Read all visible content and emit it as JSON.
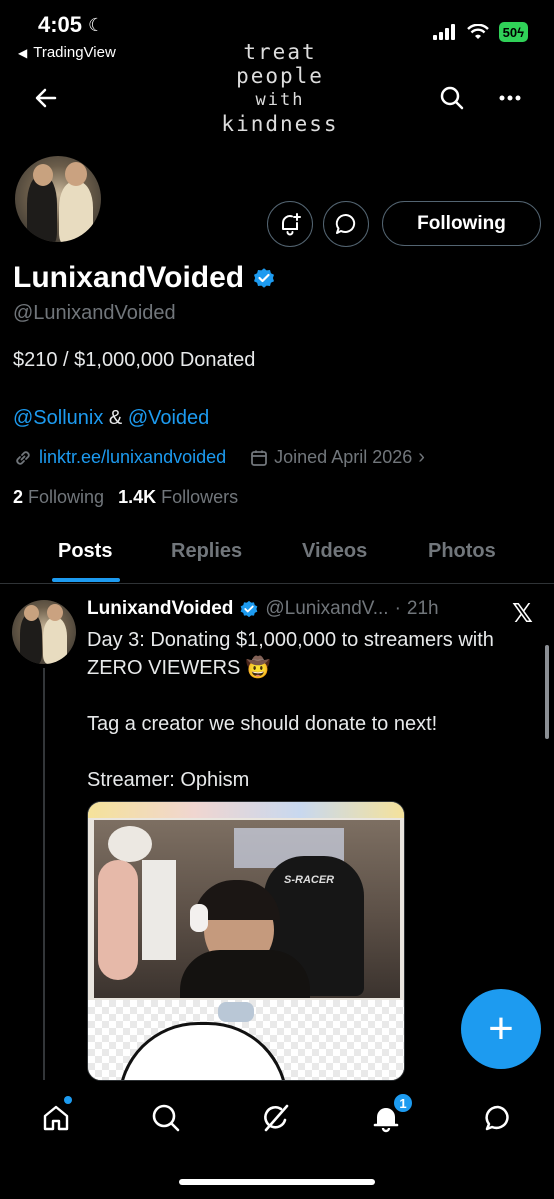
{
  "status_bar": {
    "time": "4:05",
    "back_app": "TradingView",
    "battery": "50"
  },
  "banner": {
    "text_lines": [
      "treat",
      "people",
      "with",
      "kindness"
    ]
  },
  "profile": {
    "name": "LunixandVoided",
    "handle": "@LunixandVoided",
    "bio_line1": "$210 / $1,000,000 Donated",
    "bio_mention1": "@Sollunix",
    "bio_and": "&",
    "bio_mention2": "@Voided",
    "website": "linktr.ee/lunixandvoided",
    "joined": "Joined April 2026",
    "following_count": "2",
    "following_label": "Following",
    "followers_count": "1.4K",
    "followers_label": "Followers",
    "follow_button": "Following"
  },
  "tabs": [
    {
      "label": "Posts",
      "active": true
    },
    {
      "label": "Replies",
      "active": false
    },
    {
      "label": "Videos",
      "active": false
    },
    {
      "label": "Photos",
      "active": false
    }
  ],
  "post": {
    "author": "LunixandVoided",
    "handle": "@LunixandV...",
    "separator": "·",
    "time": "21h",
    "text": "Day 3: Donating $1,000,000 to streamers with ZERO VIEWERS 🤠\n\nTag a creator we should donate to next!\n\nStreamer: Ophism",
    "media_overlay_text": "S-RACER"
  },
  "fab": {
    "label": "+"
  },
  "bottom_nav": {
    "notifications_badge": "1"
  },
  "colors": {
    "accent": "#1d9bf0",
    "background": "#000000",
    "muted": "#71767b",
    "border": "#2f3336"
  },
  "icons": [
    "back-arrow-icon",
    "search-icon",
    "more-icon",
    "bell-plus-icon",
    "message-icon",
    "verified-icon",
    "link-icon",
    "calendar-icon",
    "x-logo-icon",
    "home-icon",
    "grok-icon",
    "bell-icon",
    "chat-icon"
  ]
}
